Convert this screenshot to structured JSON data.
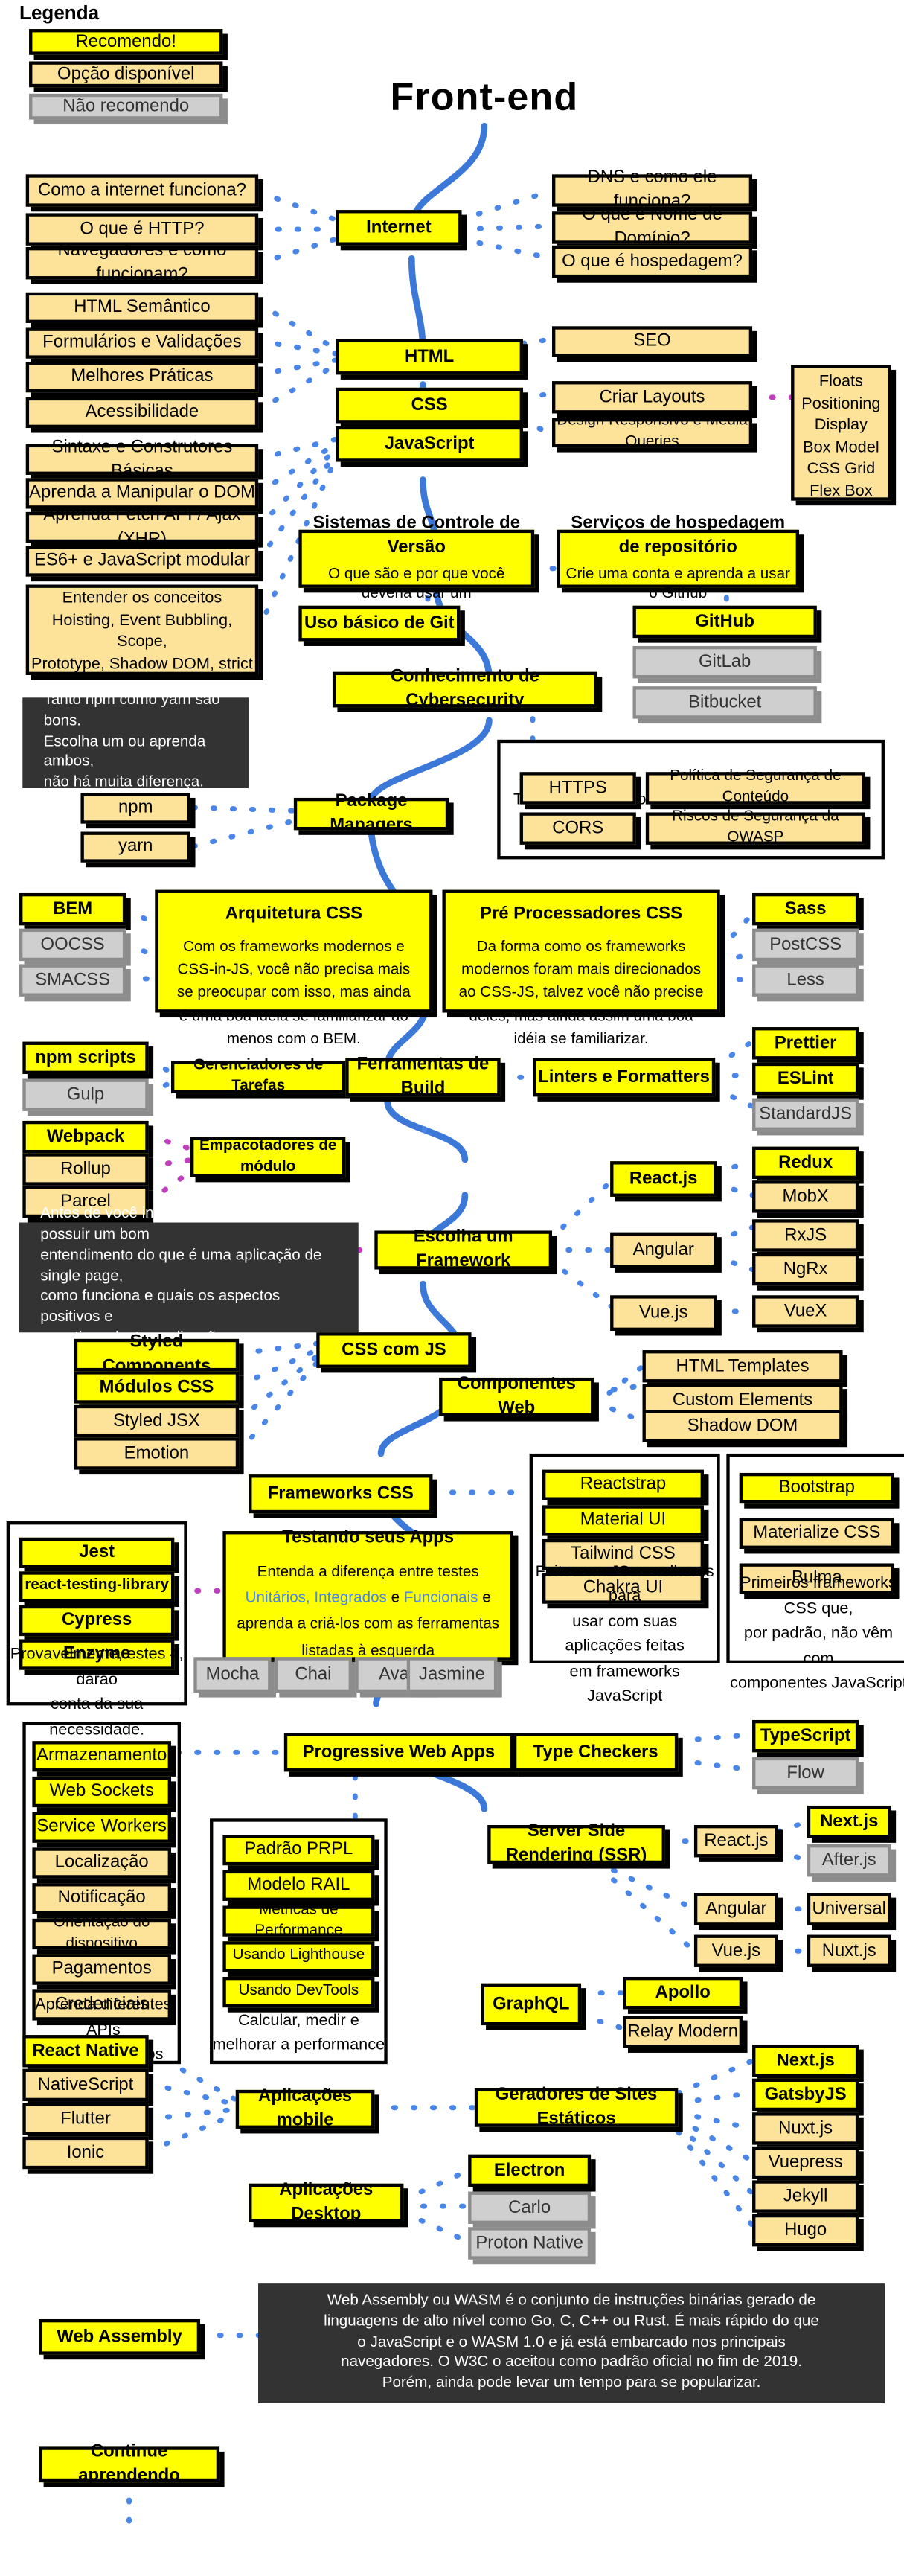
{
  "title": "Front-end",
  "legend": {
    "heading": "Legenda",
    "items": [
      {
        "label": "Recomendo!",
        "style": "rec"
      },
      {
        "label": "Opção disponível",
        "style": "opt"
      },
      {
        "label": "Não recomendo",
        "style": "no"
      }
    ]
  },
  "colors": {
    "recommended": "#ffff00",
    "available": "#fde39a",
    "not_recommended": "#cfcfcf",
    "note": "#333333",
    "link_blue": "#4a86e8",
    "link_purple": "#bf3fbf",
    "curve_blue": "#3b78d8"
  },
  "internet": {
    "main": "Internet",
    "left": [
      "Como a internet funciona?",
      "O que é HTTP?",
      "Navegadores e como funcionam?"
    ],
    "right": [
      "DNS e como ele funciona?",
      "O que é Nome de Domínio?",
      "O que é hospedagem?"
    ]
  },
  "html": {
    "main": "HTML",
    "left": [
      "HTML Semântico",
      "Formulários e Validações",
      "Melhores Práticas",
      "Acessibilidade"
    ],
    "right": [
      "SEO"
    ]
  },
  "css": {
    "main": "CSS",
    "right": [
      "Criar Layouts",
      "Design Responsivo e Media Queries"
    ],
    "layout_list": [
      "Floats",
      "Positioning",
      "Display",
      "Box Model",
      "CSS Grid",
      "Flex Box"
    ]
  },
  "javascript": {
    "main": "JavaScript",
    "left": [
      "Sintaxe e Construtores Básicas",
      "Aprenda a Manipular o DOM",
      "Aprenda Fetch API / Ajax (XHR)",
      "ES6+ e JavaScript modular"
    ],
    "concepts": {
      "line1": "Entender os conceitos",
      "line2": "Hoisting, Event Bubbling, Scope,",
      "line3": "Prototype, Shadow DOM, strict"
    }
  },
  "version_control": {
    "main": "Sistemas de Controle de Versão",
    "sub": "O que são e por que você deveria usar um",
    "child": "Uso básico de Git"
  },
  "repo_hosting": {
    "main": "Serviços de hospedagem de repositório",
    "sub": "Crie uma conta e aprenda a usar o Github",
    "children": [
      {
        "label": "GitHub",
        "style": "rec"
      },
      {
        "label": "GitLab",
        "style": "no"
      },
      {
        "label": "Bitbucket",
        "style": "no"
      }
    ]
  },
  "cybersecurity": {
    "main": "Conhecimento de Cybersecurity",
    "group_title": "Tenha ao menos o conhecimento básico",
    "items": [
      "HTTPS",
      "Política de Segurança de Conteúdo",
      "CORS",
      "Riscos de Segurança da OWASP"
    ]
  },
  "package_managers": {
    "main": "Package Managers",
    "note": [
      "Tanto npm como yarn são bons.",
      "Escolha um ou aprenda ambos,",
      "não há muita diferença."
    ],
    "children": [
      {
        "label": "npm",
        "style": "opt"
      },
      {
        "label": "yarn",
        "style": "opt"
      }
    ]
  },
  "css_architecture": {
    "main": "Arquitetura CSS",
    "body": "Com os frameworks modernos e CSS-in-JS, você não precisa mais se preocupar com isso, mas ainda é uma boa ideia se familiarizar ao menos com o BEM.",
    "children": [
      {
        "label": "BEM",
        "style": "rec"
      },
      {
        "label": "OOCSS",
        "style": "no"
      },
      {
        "label": "SMACSS",
        "style": "no"
      }
    ]
  },
  "css_preprocessors": {
    "main": "Pré Processadores CSS",
    "body": "Da forma como os frameworks modernos foram mais direcionados ao CSS-JS, talvez você não precise deles, mas ainda assim uma boa idéia se familiarizar.",
    "children": [
      {
        "label": "Sass",
        "style": "rec"
      },
      {
        "label": "PostCSS",
        "style": "no"
      },
      {
        "label": "Less",
        "style": "no"
      }
    ]
  },
  "build_tools": {
    "main": "Ferramentas de Build",
    "task_runners": {
      "main": "Gerenciadores de Tarefas",
      "children": [
        {
          "label": "npm scripts",
          "style": "rec"
        },
        {
          "label": "Gulp",
          "style": "no"
        }
      ]
    },
    "linters": {
      "main": "Linters e Formatters",
      "children": [
        {
          "label": "Prettier",
          "style": "rec"
        },
        {
          "label": "ESLint",
          "style": "rec"
        },
        {
          "label": "StandardJS",
          "style": "no"
        }
      ]
    },
    "bundlers": {
      "main": "Empacotadores de módulo",
      "children": [
        {
          "label": "Webpack",
          "style": "rec"
        },
        {
          "label": "Rollup",
          "style": "opt"
        },
        {
          "label": "Parcel",
          "style": "opt"
        }
      ]
    }
  },
  "framework": {
    "main": "Escolha um Framework",
    "note": [
      "Antes de você iniciar este passo, deve possuir um bom",
      "entendimento do que é uma aplicação de single page,",
      "como funciona e quais os aspectos positivos e",
      "negativos destas aplicações."
    ],
    "options": [
      {
        "name": "React.js",
        "style": "rec",
        "state": [
          {
            "label": "Redux",
            "style": "rec"
          },
          {
            "label": "MobX",
            "style": "opt"
          }
        ]
      },
      {
        "name": "Angular",
        "style": "opt",
        "state": [
          {
            "label": "RxJS",
            "style": "opt"
          },
          {
            "label": "NgRx",
            "style": "opt"
          }
        ]
      },
      {
        "name": "Vue.js",
        "style": "opt",
        "state": [
          {
            "label": "VueX",
            "style": "opt"
          }
        ]
      }
    ]
  },
  "css_in_js": {
    "main": "CSS com JS",
    "children": [
      {
        "label": "Styled Components",
        "style": "rec"
      },
      {
        "label": "Módulos CSS",
        "style": "rec"
      },
      {
        "label": "Styled JSX",
        "style": "opt"
      },
      {
        "label": "Emotion",
        "style": "opt"
      }
    ]
  },
  "web_components": {
    "main": "Componentes Web",
    "children": [
      {
        "label": "HTML Templates",
        "style": "opt"
      },
      {
        "label": "Custom Elements",
        "style": "opt"
      },
      {
        "label": "Shadow DOM",
        "style": "opt"
      }
    ]
  },
  "css_frameworks": {
    "main": "Frameworks CSS",
    "group_js": {
      "items": [
        {
          "label": "Reactstrap",
          "style": "rec"
        },
        {
          "label": "Material UI",
          "style": "rec"
        },
        {
          "label": "Tailwind CSS",
          "style": "opt"
        },
        {
          "label": "Chakra UI",
          "style": "opt"
        }
      ],
      "caption": [
        "Feitos em JS e melhores para",
        "usar com suas aplicações feitas",
        "em frameworks JavaScript"
      ]
    },
    "group_css": {
      "items": [
        {
          "label": "Bootstrap",
          "style": "rec"
        },
        {
          "label": "Materialize CSS",
          "style": "opt"
        },
        {
          "label": "Bulma",
          "style": "opt"
        }
      ],
      "caption": [
        "Primeiros frameworks CSS que,",
        "por padrão, não vêm com",
        "componentes JavaScript"
      ]
    }
  },
  "testing": {
    "main": "Testando seus Apps",
    "body_parts": [
      {
        "text": "Entenda a diferença entre testes ",
        "color": "black"
      },
      {
        "text": "Unitários,",
        "color": "blue"
      },
      {
        "text": "Integrados",
        "color": "blue"
      },
      {
        "text": " e ",
        "color": "black"
      },
      {
        "text": "Funcionais",
        "color": "blue"
      },
      {
        "text": " e aprenda a criá-los",
        "color": "black"
      },
      {
        "text": "com as ferramentas listadas à esquerda",
        "color": "black"
      }
    ],
    "tools_group": {
      "items": [
        {
          "label": "Jest",
          "style": "rec"
        },
        {
          "label": "react-testing-library",
          "style": "rec"
        },
        {
          "label": "Cypress",
          "style": "rec"
        },
        {
          "label": "Enzyme",
          "style": "rec"
        }
      ],
      "caption": [
        "Provavelmente, estes 4, darão",
        "conta da sua necessidade."
      ]
    },
    "others": [
      {
        "label": "Mocha",
        "style": "no"
      },
      {
        "label": "Chai",
        "style": "no"
      },
      {
        "label": "Ava",
        "style": "no"
      },
      {
        "label": "Jasmine",
        "style": "no"
      }
    ]
  },
  "pwa": {
    "main": "Progressive Web Apps",
    "apis_group": {
      "items": [
        {
          "label": "Armazenamento",
          "style": "rec"
        },
        {
          "label": "Web Sockets",
          "style": "rec"
        },
        {
          "label": "Service Workers",
          "style": "rec"
        },
        {
          "label": "Localização",
          "style": "opt"
        },
        {
          "label": "Notificação",
          "style": "opt"
        },
        {
          "label": "Orientação do dispositivo",
          "style": "opt"
        },
        {
          "label": "Pagamentos",
          "style": "opt"
        },
        {
          "label": "Credenciais",
          "style": "opt"
        }
      ],
      "caption": [
        "Aprenda diferentes APIs",
        "Web usadas nos PWAs"
      ]
    },
    "perf_group": {
      "items": [
        {
          "label": "Padrão PRPL",
          "style": "rec"
        },
        {
          "label": "Modelo RAIL",
          "style": "rec"
        },
        {
          "label": "Métricas de Performance",
          "style": "rec"
        },
        {
          "label": "Usando Lighthouse",
          "style": "rec"
        },
        {
          "label": "Usando DevTools",
          "style": "rec"
        }
      ],
      "caption": [
        "Calcular, medir e",
        "melhorar a performance"
      ]
    }
  },
  "type_checkers": {
    "main": "Type Checkers",
    "children": [
      {
        "label": "TypeScript",
        "style": "rec"
      },
      {
        "label": "Flow",
        "style": "no"
      }
    ]
  },
  "ssr": {
    "main": "Server Side Rendering (SSR)",
    "rows": [
      {
        "framework": "React.js",
        "style": "opt",
        "children": [
          {
            "label": "Next.js",
            "style": "rec"
          },
          {
            "label": "After.js",
            "style": "no"
          }
        ]
      },
      {
        "framework": "Angular",
        "style": "opt",
        "children": [
          {
            "label": "Universal",
            "style": "opt"
          }
        ]
      },
      {
        "framework": "Vue.js",
        "style": "opt",
        "children": [
          {
            "label": "Nuxt.js",
            "style": "opt"
          }
        ]
      }
    ]
  },
  "graphql": {
    "main": "GraphQL",
    "children": [
      {
        "label": "Apollo",
        "style": "rec"
      },
      {
        "label": "Relay Modern",
        "style": "opt"
      }
    ]
  },
  "static_site": {
    "main": "Geradores de Sites Estáticos",
    "children": [
      {
        "label": "Next.js",
        "style": "rec"
      },
      {
        "label": "GatsbyJS",
        "style": "rec"
      },
      {
        "label": "Nuxt.js",
        "style": "opt"
      },
      {
        "label": "Vuepress",
        "style": "opt"
      },
      {
        "label": "Jekyll",
        "style": "opt"
      },
      {
        "label": "Hugo",
        "style": "opt"
      }
    ]
  },
  "mobile": {
    "main": "Aplicações mobile",
    "children": [
      {
        "label": "React Native",
        "style": "rec"
      },
      {
        "label": "NativeScript",
        "style": "opt"
      },
      {
        "label": "Flutter",
        "style": "opt"
      },
      {
        "label": "Ionic",
        "style": "opt"
      }
    ]
  },
  "desktop": {
    "main": "Aplicações Desktop",
    "children": [
      {
        "label": "Electron",
        "style": "rec"
      },
      {
        "label": "Carlo",
        "style": "no"
      },
      {
        "label": "Proton Native",
        "style": "no"
      }
    ]
  },
  "web_assembly": {
    "main": "Web Assembly",
    "note": [
      "Web Assembly ou WASM é o conjunto de instruções binárias gerado de",
      "linguagens de alto nível como Go, C, C++ ou Rust. É mais rápido do que",
      "o JavaScript e o WASM 1.0 e já está embarcado nos principais",
      "navegadores. O W3C o aceitou como padrão oficial no fim de 2019.",
      "Porém, ainda pode levar um tempo para se popularizar."
    ]
  },
  "footer": {
    "main": "Continue aprendendo"
  }
}
